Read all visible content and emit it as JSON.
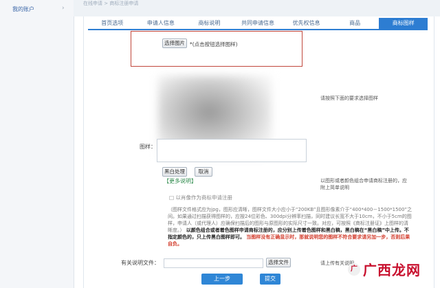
{
  "sidebar": {
    "account": "我的账户"
  },
  "topbar": {
    "breadcrumb": "在线申请 > 商标注册申请"
  },
  "tabs": [
    {
      "label": "首页选项"
    },
    {
      "label": "申请人信息"
    },
    {
      "label": "商标说明"
    },
    {
      "label": "共同申请信息"
    },
    {
      "label": "优先权信息"
    },
    {
      "label": "商品"
    },
    {
      "label": "商标图样"
    }
  ],
  "upload": {
    "button": "选择图片",
    "hint": "*(点击按钮选择图样)"
  },
  "preview": {
    "side_note": "请按照下面的要求选择图样"
  },
  "image_field": {
    "label": "图样："
  },
  "image_actions": {
    "upload": "黑白处理",
    "cancel": "取消"
  },
  "more": {
    "label": "【更多说明】",
    "line1": "以图形或者颜色组合申请商标注册的，应",
    "line2": "附上简单说明"
  },
  "checkbox_text": "□ 以肖像作为商标申请注册",
  "note": {
    "gray": "（图样文件格式应为jpg，图形应清晰，图样文件大小应小于“200KB”且图形像素介于“400*400－1500*1500”之间。如果通过扫描获得图样的，应按24位彩色、300dpi分辨率扫描，同时建议长宽不大于10cm，不小于5cm的图样，申请人（或代理人）应确保扫描后的图形与原图形的实际尺寸一致。对应，可按照《商标注册证》上图样的清晰度。）",
    "bold1": "以颜色组合或者着色图样申请商标注册的，应分别上传着色图样和黑白稿，黑白稿在“黑白稿”中上传。不指定颜色的，只上传黑白图样即可。",
    "red": "当图样没有正确显示时，那就说明您的图样不符合要求请另加一步，否则后果自负。"
  },
  "related_file": {
    "label": "有关说明文件：",
    "button": "选择文件",
    "side_note": "请上传有关说明"
  },
  "nav": {
    "prev": "上一步",
    "next": "提交"
  },
  "watermark": {
    "logo": "广",
    "text": "广西龙网"
  }
}
